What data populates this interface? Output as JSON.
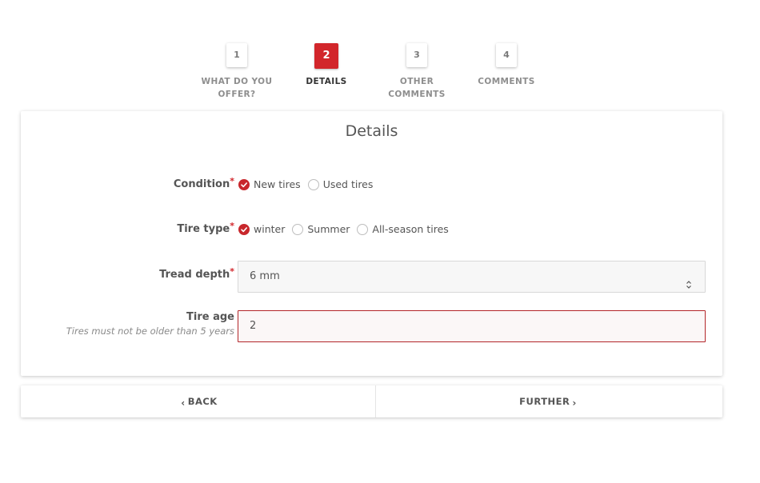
{
  "stepper": {
    "steps": [
      {
        "number": "1",
        "label_line1": "WHAT DO YOU",
        "label_line2": "OFFER?"
      },
      {
        "number": "2",
        "label_line1": "DETAILS",
        "label_line2": ""
      },
      {
        "number": "3",
        "label_line1": "OTHER",
        "label_line2": "COMMENTS"
      },
      {
        "number": "4",
        "label_line1": "COMMENTS",
        "label_line2": ""
      }
    ],
    "active_step": 2
  },
  "form": {
    "title": "Details",
    "required_marker": "*",
    "condition": {
      "label": "Condition",
      "options": [
        "New tires",
        "Used tires"
      ],
      "selected": "New tires"
    },
    "tire_type": {
      "label": "Tire type",
      "options": [
        "winter",
        "Summer",
        "All-season tires"
      ],
      "selected": "winter"
    },
    "tread_depth": {
      "label": "Tread depth",
      "value": "6 mm"
    },
    "tire_age": {
      "label": "Tire age",
      "hint": "Tires must not be older than 5 years",
      "value": "2"
    }
  },
  "nav": {
    "back_label": "BACK",
    "further_label": "FURTHER",
    "back_icon": "chevron-left-icon",
    "further_icon": "chevron-right-icon"
  },
  "colors": {
    "accent": "#d2262b",
    "error_border": "#b3262a",
    "text": "#555555"
  }
}
